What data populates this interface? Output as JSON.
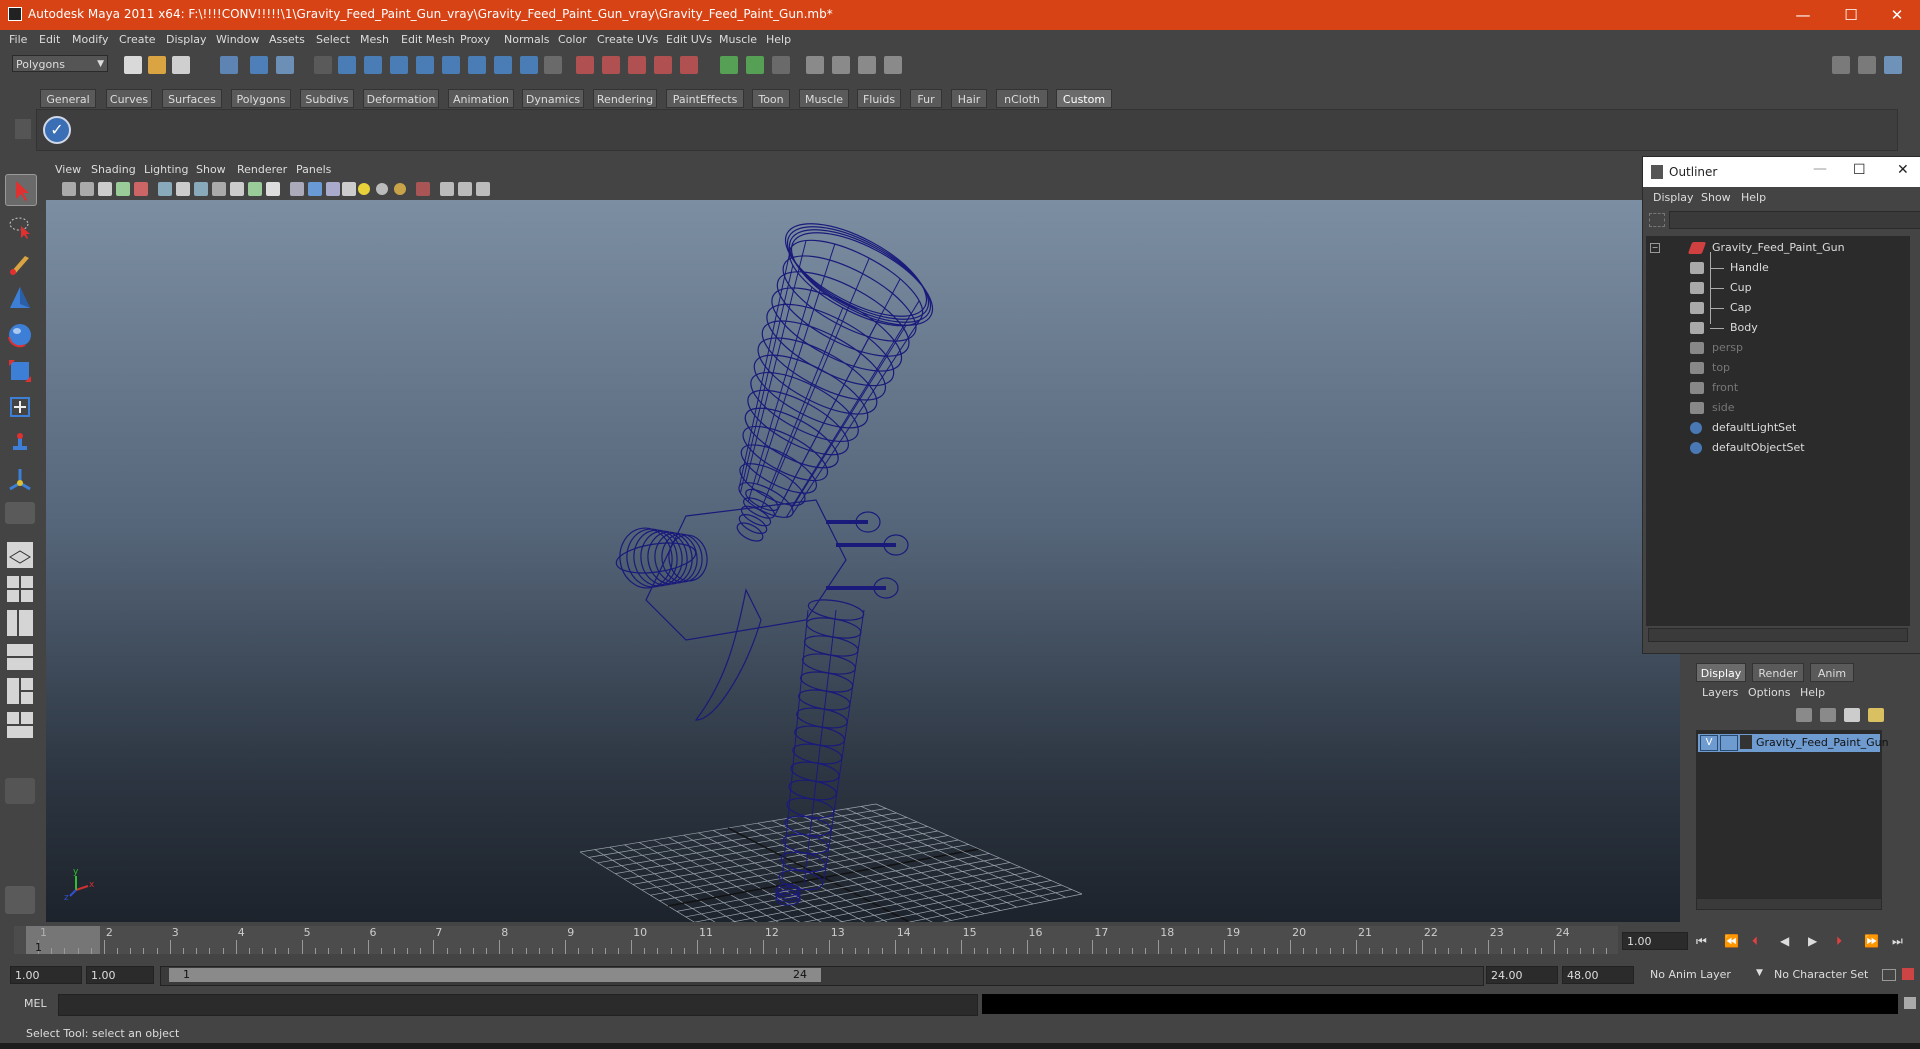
{
  "window": {
    "title": "Autodesk Maya 2011 x64: F:\\!!!!CONV!!!!!\\1\\Gravity_Feed_Paint_Gun_vray\\Gravity_Feed_Paint_Gun_vray\\Gravity_Feed_Paint_Gun.mb*",
    "minimize": "—",
    "maximize": "☐",
    "close": "✕"
  },
  "menubar": [
    "File",
    "Edit",
    "Modify",
    "Create",
    "Display",
    "Window",
    "Assets",
    "Select",
    "Mesh",
    "Edit Mesh",
    "Proxy",
    "Normals",
    "Color",
    "Create UVs",
    "Edit UVs",
    "Muscle",
    "Help"
  ],
  "status_line": {
    "mode": "Polygons"
  },
  "shelf": {
    "tabs": [
      "General",
      "Curves",
      "Surfaces",
      "Polygons",
      "Subdivs",
      "Deformation",
      "Animation",
      "Dynamics",
      "Rendering",
      "PaintEffects",
      "Toon",
      "Muscle",
      "Fluids",
      "Fur",
      "Hair",
      "nCloth",
      "Custom"
    ],
    "active_tab": "Custom"
  },
  "viewport": {
    "menus": [
      "View",
      "Shading",
      "Lighting",
      "Show",
      "Renderer",
      "Panels"
    ],
    "wire_color": "#1a1a7a",
    "axis": {
      "x": "x",
      "y": "y",
      "z": "z"
    }
  },
  "outliner": {
    "title": "Outliner",
    "menus": [
      "Display",
      "Show",
      "Help"
    ],
    "items": [
      {
        "label": "Gravity_Feed_Paint_Gun",
        "kind": "group",
        "dim": false
      },
      {
        "label": "Handle",
        "kind": "child",
        "dim": false
      },
      {
        "label": "Cup",
        "kind": "child",
        "dim": false
      },
      {
        "label": "Cap",
        "kind": "child",
        "dim": false
      },
      {
        "label": "Body",
        "kind": "child",
        "dim": false
      },
      {
        "label": "persp",
        "kind": "camera",
        "dim": true
      },
      {
        "label": "top",
        "kind": "camera",
        "dim": true
      },
      {
        "label": "front",
        "kind": "camera",
        "dim": true
      },
      {
        "label": "side",
        "kind": "camera",
        "dim": true
      },
      {
        "label": "defaultLightSet",
        "kind": "set",
        "dim": false
      },
      {
        "label": "defaultObjectSet",
        "kind": "set",
        "dim": false
      }
    ]
  },
  "layer_editor": {
    "tabs": [
      "Display",
      "Render",
      "Anim"
    ],
    "active_tab": "Display",
    "menus": [
      "Layers",
      "Options",
      "Help"
    ],
    "layer": {
      "visible": "V",
      "name": "Gravity_Feed_Paint_Gun"
    }
  },
  "timeline": {
    "ticks": [
      "1",
      "2",
      "3",
      "4",
      "5",
      "6",
      "7",
      "8",
      "9",
      "10",
      "11",
      "12",
      "13",
      "14",
      "15",
      "16",
      "17",
      "18",
      "19",
      "20",
      "21",
      "22",
      "23",
      "24"
    ],
    "current_frame": "1",
    "current_time_field": "1.00"
  },
  "range": {
    "start": "1.00",
    "playback_start": "1.00",
    "slider_start": "1",
    "slider_end": "24",
    "playback_end": "24.00",
    "end": "48.00",
    "anim_layer": "No Anim Layer",
    "character_set": "No Character Set"
  },
  "command_line": {
    "label": "MEL"
  },
  "help_line": {
    "text": "Select Tool: select an object"
  }
}
